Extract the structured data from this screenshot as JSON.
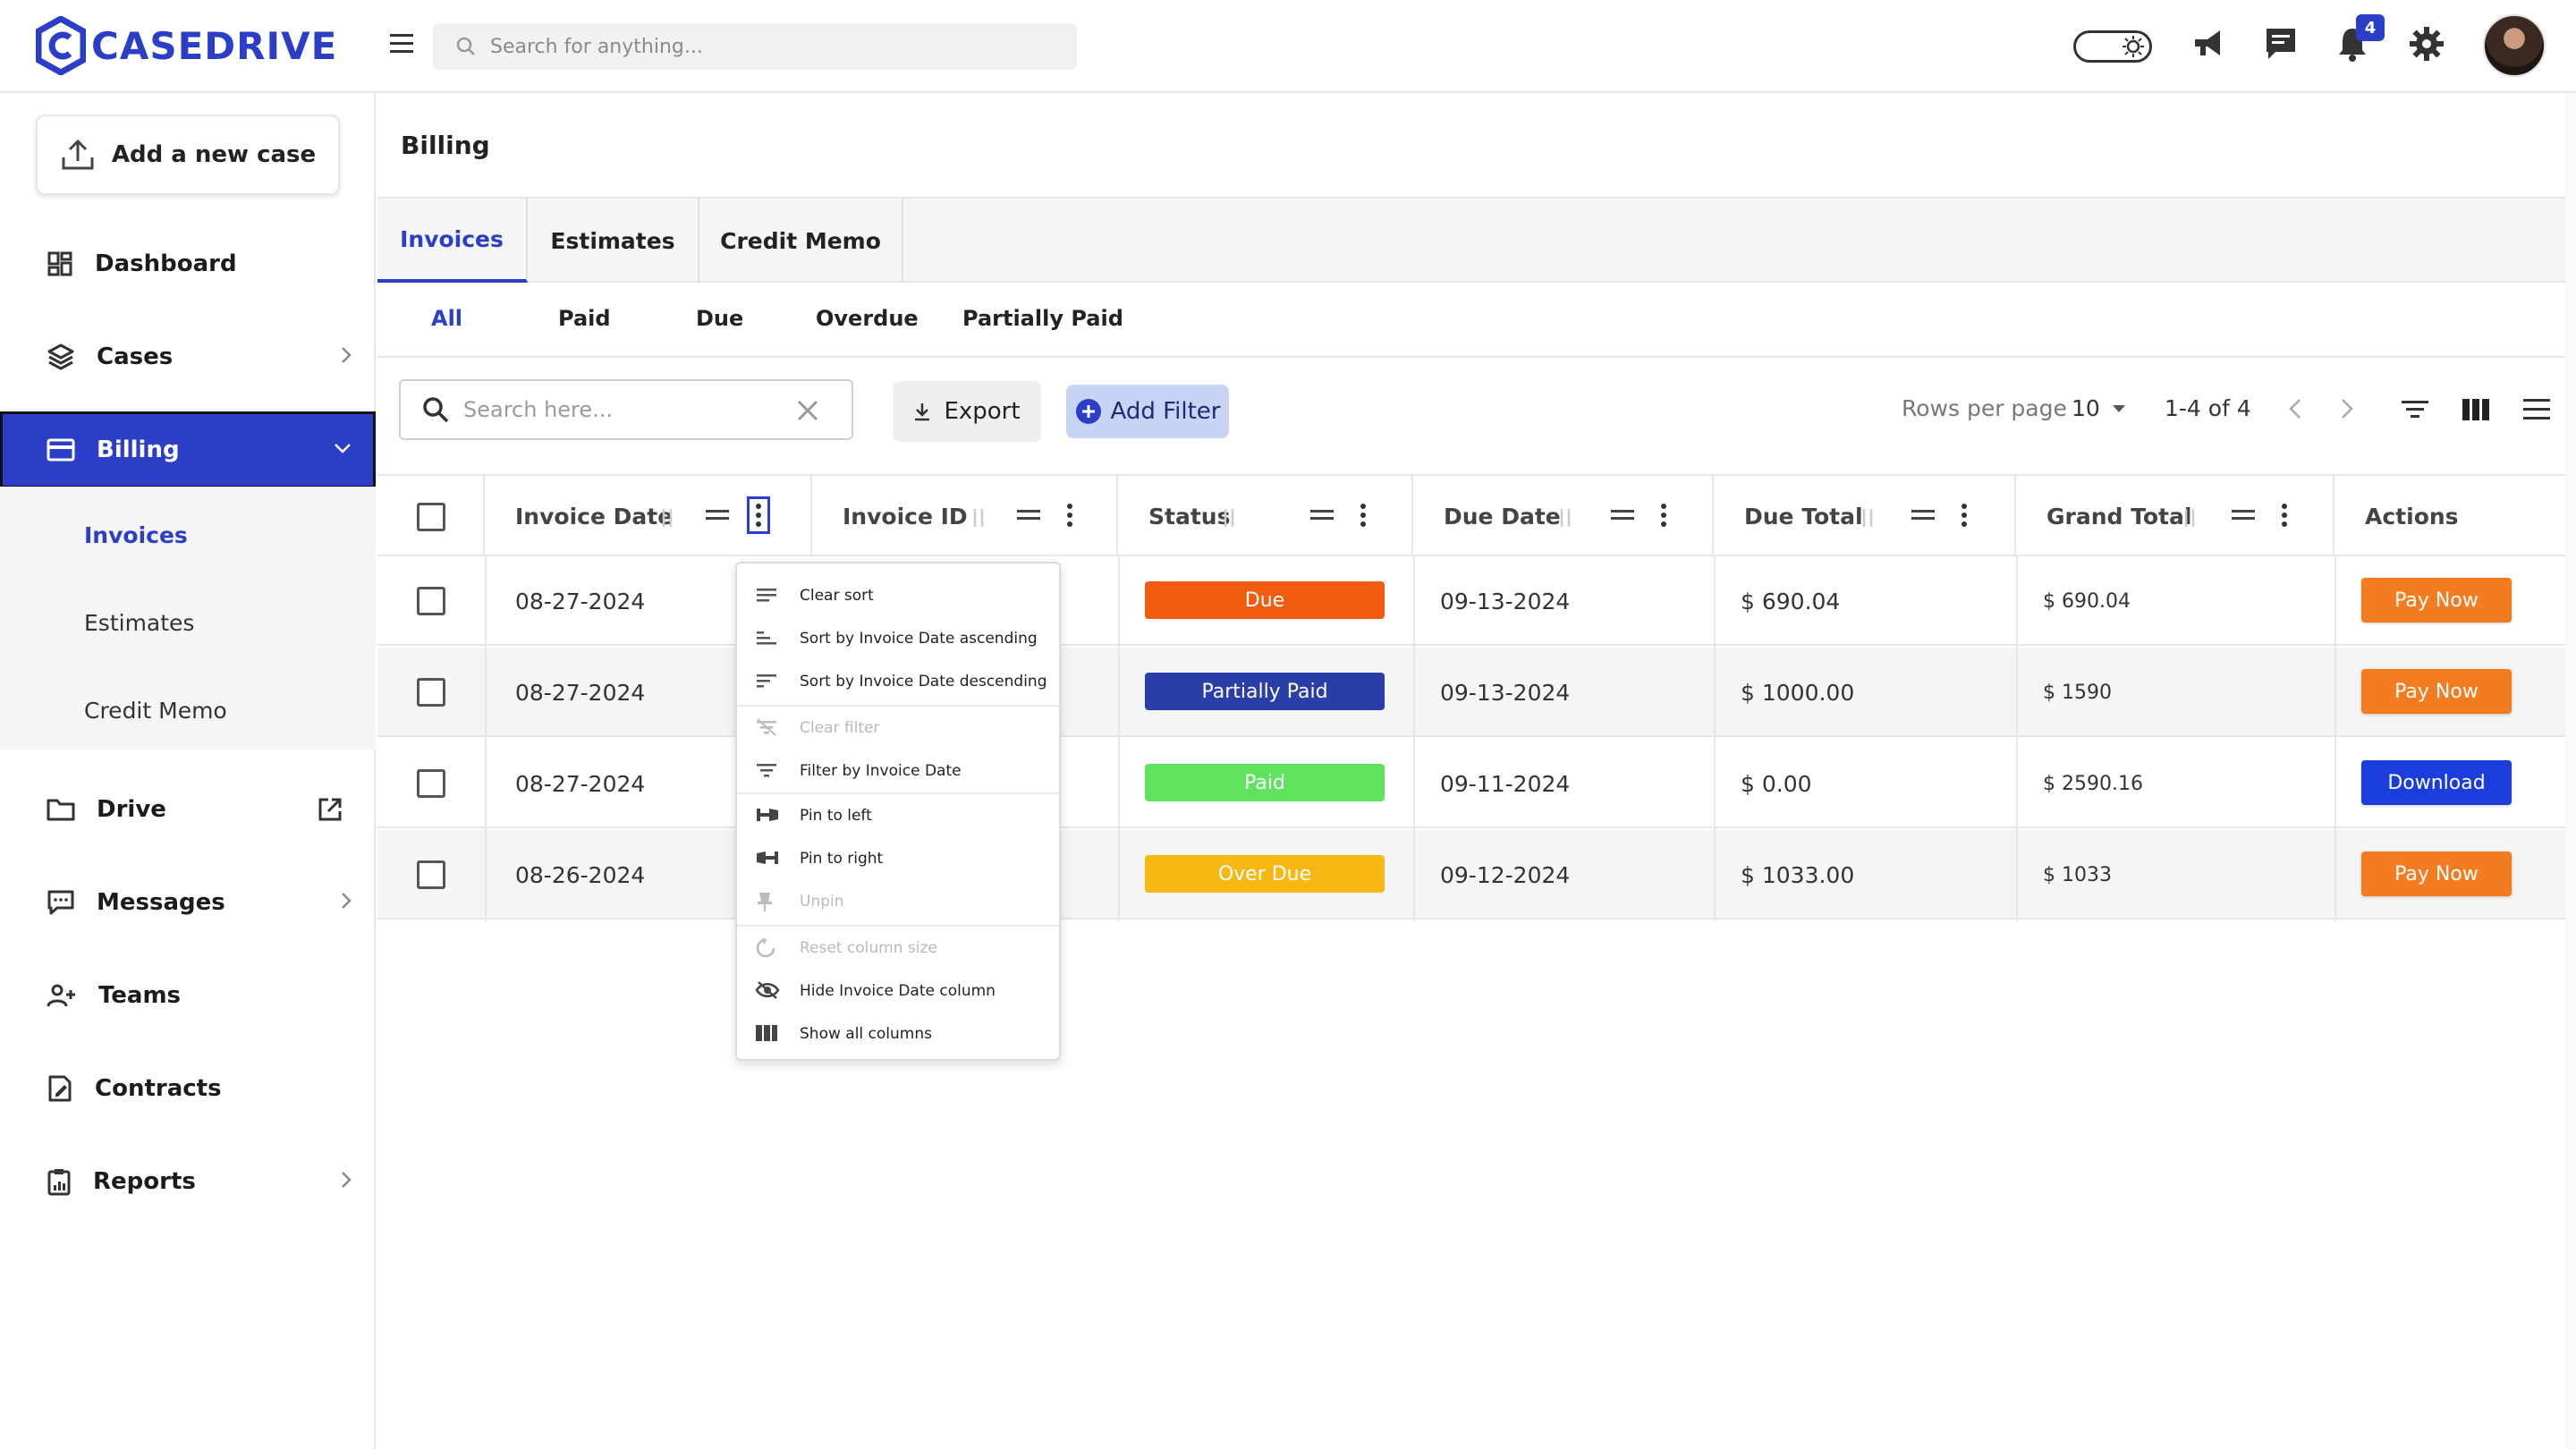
{
  "brand": {
    "name": "CASEDRIVE",
    "color": "#2a3ec8"
  },
  "topbar": {
    "search_placeholder": "Search for anything...",
    "notification_count": "4",
    "icons": [
      "menu-icon",
      "search-icon",
      "theme-toggle",
      "megaphone-icon",
      "chat-icon",
      "bell-icon",
      "gear-icon",
      "avatar"
    ]
  },
  "sidebar": {
    "add_case_label": "Add a new case",
    "items": [
      {
        "label": "Dashboard",
        "icon": "dashboard-icon"
      },
      {
        "label": "Cases",
        "icon": "layers-icon"
      },
      {
        "label": "Billing",
        "icon": "card-icon",
        "active": true
      },
      {
        "label": "Drive",
        "icon": "folder-icon"
      },
      {
        "label": "Messages",
        "icon": "message-icon"
      },
      {
        "label": "Teams",
        "icon": "users-icon"
      },
      {
        "label": "Contracts",
        "icon": "contract-icon"
      },
      {
        "label": "Reports",
        "icon": "clipboard-icon"
      }
    ],
    "billing_sub": [
      "Invoices",
      "Estimates",
      "Credit Memo"
    ]
  },
  "page": {
    "title": "Billing",
    "tabs": [
      "Invoices",
      "Estimates",
      "Credit Memo"
    ],
    "filters": [
      "All",
      "Paid",
      "Due",
      "Overdue",
      "Partially Paid"
    ]
  },
  "toolbar": {
    "search_placeholder": "Search here...",
    "export_label": "Export",
    "add_filter_label": "Add Filter",
    "rows_per_page_label": "Rows per page",
    "rows_per_page_value": "10",
    "range": "1-4 of 4"
  },
  "table": {
    "columns": [
      "Invoice Date",
      "Invoice ID",
      "Status",
      "Due Date",
      "Due Total",
      "Grand Total",
      "Actions"
    ],
    "rows": [
      {
        "invoice_date": "08-27-2024",
        "status": "Due",
        "status_color": "#f25c10",
        "due_date": "09-13-2024",
        "due_total": "$ 690.04",
        "grand_total": "$ 690.04",
        "action": "Pay Now",
        "action_color": "#f47c20"
      },
      {
        "invoice_date": "08-27-2024",
        "status": "Partially Paid",
        "status_color": "#2b3ea8",
        "due_date": "09-13-2024",
        "due_total": "$ 1000.00",
        "grand_total": "$ 1590",
        "action": "Pay Now",
        "action_color": "#f47c20"
      },
      {
        "invoice_date": "08-27-2024",
        "status": "Paid",
        "status_color": "#5fe35f",
        "due_date": "09-11-2024",
        "due_total": "$ 0.00",
        "grand_total": "$ 2590.16",
        "action": "Download",
        "action_color": "#1b3ddc"
      },
      {
        "invoice_date": "08-26-2024",
        "status": "Over Due",
        "status_color": "#f7b814",
        "due_date": "09-12-2024",
        "due_total": "$ 1033.00",
        "grand_total": "$ 1033",
        "action": "Pay Now",
        "action_color": "#f47c20"
      }
    ]
  },
  "column_menu": {
    "items": [
      {
        "label": "Clear sort",
        "disabled": false,
        "icon": "clear-sort-icon"
      },
      {
        "label": "Sort by Invoice Date ascending",
        "disabled": false,
        "icon": "sort-asc-icon"
      },
      {
        "label": "Sort by Invoice Date descending",
        "disabled": false,
        "icon": "sort-desc-icon"
      },
      {
        "label": "Clear filter",
        "disabled": true,
        "icon": "clear-filter-icon"
      },
      {
        "label": "Filter by Invoice Date",
        "disabled": false,
        "icon": "filter-icon"
      },
      {
        "label": "Pin to left",
        "disabled": false,
        "icon": "pin-left-icon"
      },
      {
        "label": "Pin to right",
        "disabled": false,
        "icon": "pin-right-icon"
      },
      {
        "label": "Unpin",
        "disabled": true,
        "icon": "unpin-icon"
      },
      {
        "label": "Reset column size",
        "disabled": true,
        "icon": "reset-icon"
      },
      {
        "label": "Hide Invoice Date column",
        "disabled": false,
        "icon": "hide-icon"
      },
      {
        "label": "Show all columns",
        "disabled": false,
        "icon": "columns-icon"
      }
    ]
  }
}
